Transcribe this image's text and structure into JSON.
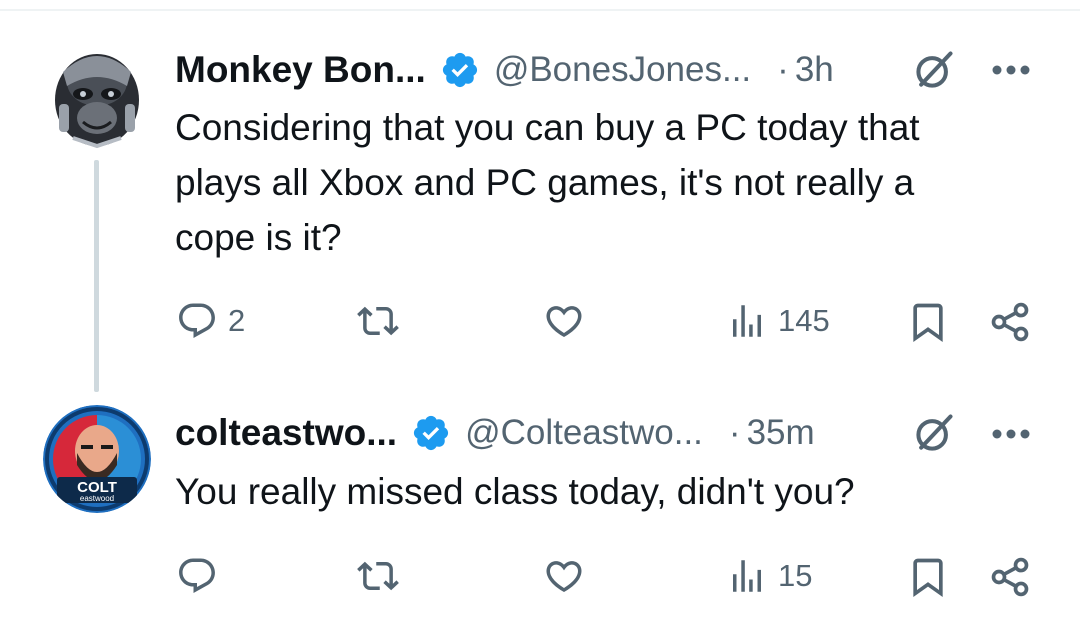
{
  "tweets": [
    {
      "display_name": "Monkey Bon...",
      "handle": "@BonesJones...",
      "separator": "·",
      "time": "3h",
      "text_lines": [
        "Considering that you can buy a PC today that",
        "plays all Xbox and PC games, it's not really a",
        "cope is it?"
      ],
      "replies": "2",
      "reposts": "",
      "likes": "",
      "views": "145"
    },
    {
      "display_name": "colteastwo...",
      "handle": "@Colteastwo...",
      "separator": "·",
      "time": "35m",
      "text_lines": [
        "You really missed class today, didn't you?"
      ],
      "replies": "",
      "reposts": "",
      "likes": "",
      "views": "15",
      "avatar_text": [
        "COLT",
        "eastwood"
      ]
    }
  ],
  "colors": {
    "verified": "#1d9bf0",
    "text": "#0f1419",
    "secondary": "#536471",
    "thread_line": "#cfd9de"
  },
  "icons": [
    "verified-badge-icon",
    "grok-icon",
    "more-icon",
    "reply-icon",
    "repost-icon",
    "like-icon",
    "views-icon",
    "bookmark-icon",
    "share-icon"
  ]
}
